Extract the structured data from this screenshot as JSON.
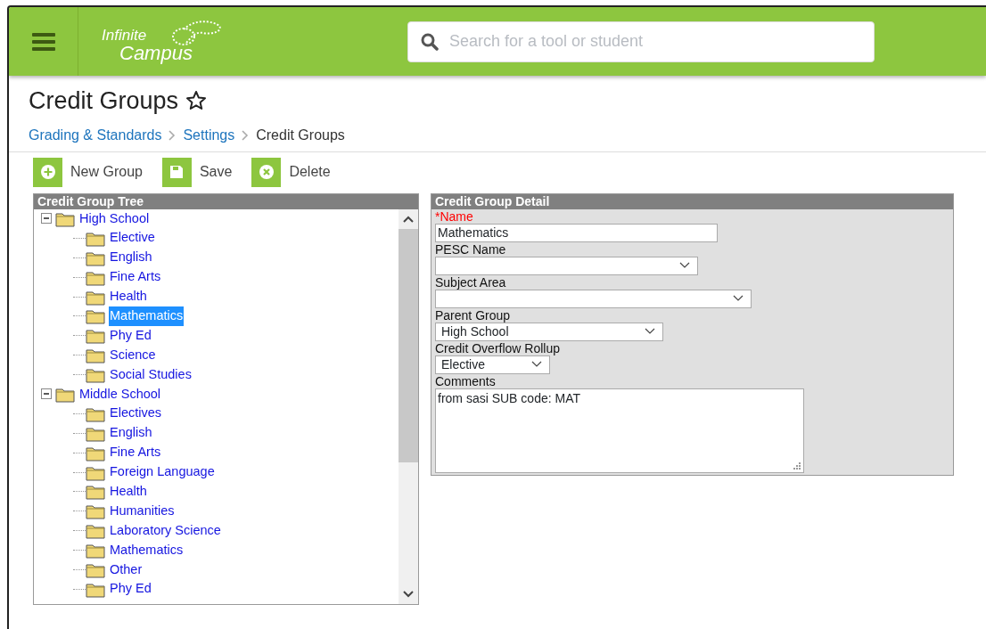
{
  "header": {
    "logo": {
      "line_1": "Infinite",
      "line_2": "Campus"
    },
    "search": {
      "placeholder": "Search for a tool or student"
    }
  },
  "page": {
    "title": "Credit Groups",
    "favorite": false
  },
  "breadcrumb": [
    {
      "label": "Grading & Standards",
      "link": true
    },
    {
      "label": "Settings",
      "link": true
    },
    {
      "label": "Credit Groups",
      "link": false
    }
  ],
  "toolbar": [
    {
      "kind": "add",
      "label": "New Group"
    },
    {
      "kind": "save",
      "label": "Save"
    },
    {
      "kind": "delete",
      "label": "Delete"
    }
  ],
  "tree": {
    "title": "Credit Group Tree",
    "items": [
      {
        "label": "High School",
        "expanded": true,
        "selected": false,
        "children": [
          {
            "label": "Elective",
            "selected": false
          },
          {
            "label": "English",
            "selected": false
          },
          {
            "label": "Fine Arts",
            "selected": false
          },
          {
            "label": "Health",
            "selected": false
          },
          {
            "label": "Mathematics",
            "selected": true
          },
          {
            "label": "Phy Ed",
            "selected": false
          },
          {
            "label": "Science",
            "selected": false
          },
          {
            "label": "Social Studies",
            "selected": false
          }
        ]
      },
      {
        "label": "Middle School",
        "expanded": true,
        "selected": false,
        "children": [
          {
            "label": "Electives",
            "selected": false
          },
          {
            "label": "English",
            "selected": false
          },
          {
            "label": "Fine Arts",
            "selected": false
          },
          {
            "label": "Foreign Language",
            "selected": false
          },
          {
            "label": "Health",
            "selected": false
          },
          {
            "label": "Humanities",
            "selected": false
          },
          {
            "label": "Laboratory Science",
            "selected": false
          },
          {
            "label": "Mathematics",
            "selected": false
          },
          {
            "label": "Other",
            "selected": false
          },
          {
            "label": "Phy Ed",
            "selected": false
          }
        ]
      }
    ]
  },
  "detail": {
    "title": "Credit Group Detail",
    "fields": [
      {
        "kind": "text",
        "label": "*Name",
        "required": true,
        "value": "Mathematics"
      },
      {
        "kind": "select",
        "label": "PESC Name",
        "required": false
      },
      {
        "kind": "select",
        "label": "Subject Area",
        "required": false
      },
      {
        "kind": "select",
        "label": "Parent Group",
        "required": false,
        "value": "High School"
      },
      {
        "kind": "select",
        "label": "Credit Overflow Rollup",
        "required": false,
        "value": "Elective"
      },
      {
        "kind": "textarea",
        "label": "Comments",
        "required": false,
        "value": "from sasi SUB code: MAT"
      }
    ]
  }
}
